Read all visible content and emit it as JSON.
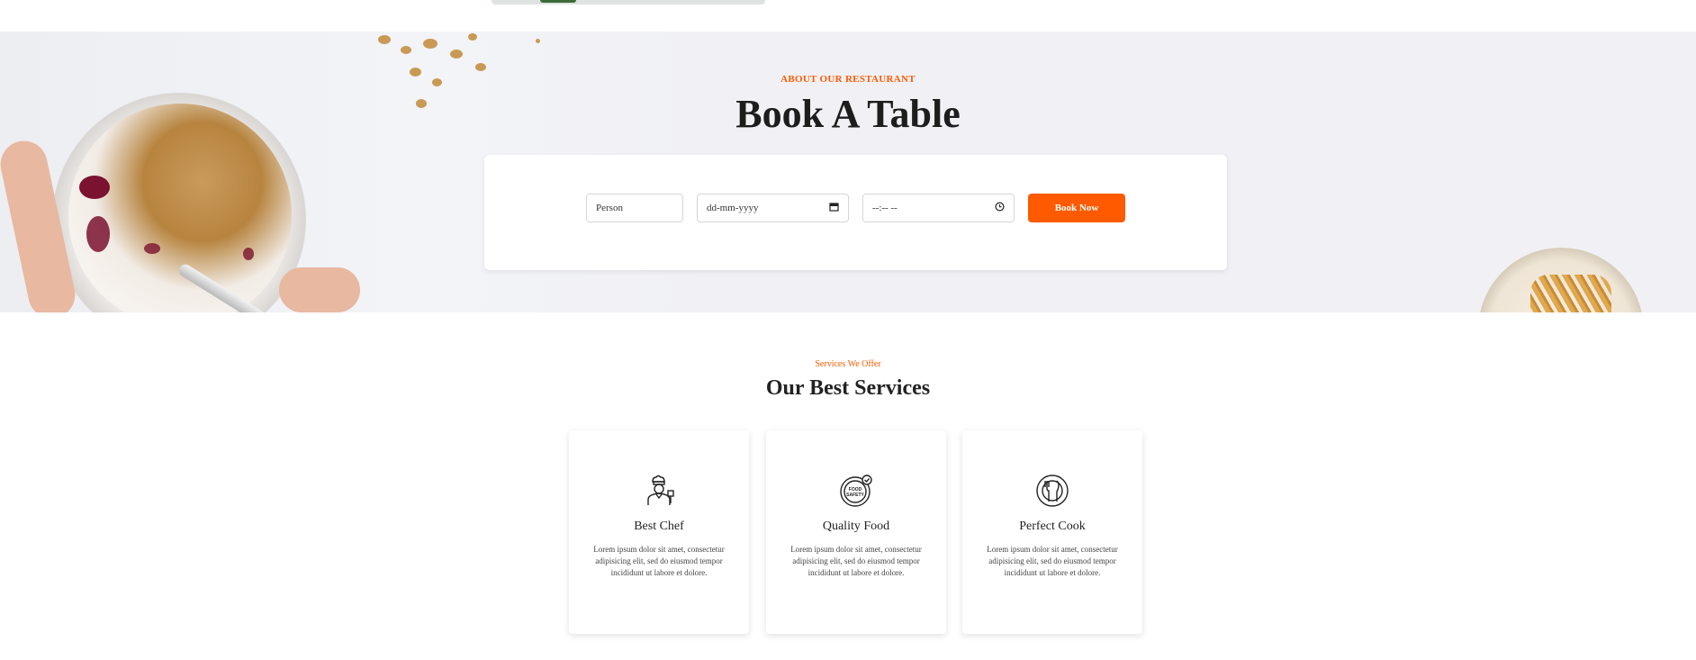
{
  "booking": {
    "kicker": "ABOUT OUR RESTAURANT",
    "title": "Book A Table",
    "person_placeholder": "Person",
    "date_placeholder": "dd-mm-yyyy",
    "time_placeholder": "--:-- --",
    "button_label": "Book Now"
  },
  "services": {
    "kicker": "Services We Offer",
    "title": "Our Best Services",
    "cards": [
      {
        "icon": "chef-icon",
        "title": "Best Chef",
        "text": "Lorem ipsum dolor sit amet, consectetur adipisicing elit, sed do eiusmod tempor incididunt ut labore et dolore."
      },
      {
        "icon": "food-safety-icon",
        "title": "Quality Food",
        "text": "Lorem ipsum dolor sit amet, consectetur adipisicing elit, sed do eiusmod tempor incididunt ut labore et dolore.",
        "icon_text": "FOOD SAFETY"
      },
      {
        "icon": "plate-cutlery-icon",
        "title": "Perfect Cook",
        "text": "Lorem ipsum dolor sit amet, consectetur adipisicing elit, sed do eiusmod tempor incididunt ut labore et dolore."
      }
    ]
  },
  "colors": {
    "accent": "#ff5a00",
    "section_bg": "#f1f1f5"
  }
}
